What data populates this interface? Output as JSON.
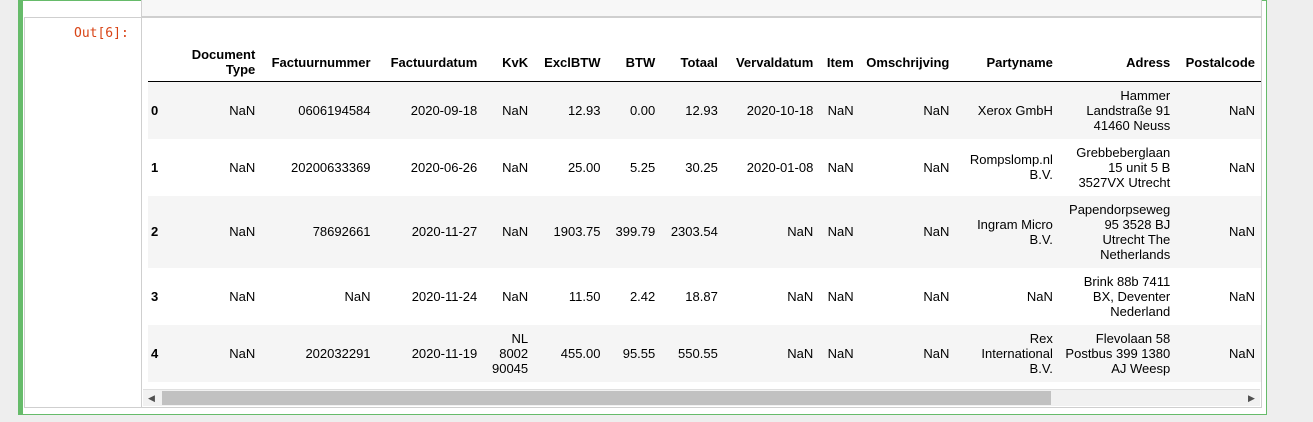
{
  "prompt": "Out[6]:",
  "columns": [
    "",
    "Document Type",
    "Factuurnummer",
    "Factuurdatum",
    "KvK",
    "ExclBTW",
    "BTW",
    "Totaal",
    "Vervaldatum",
    "Item",
    "Omschrijving",
    "Partyname",
    "Adress",
    "Postalcode"
  ],
  "rows": [
    [
      "0",
      "NaN",
      "0606194584",
      "2020-09-18",
      "NaN",
      "12.93",
      "0.00",
      "12.93",
      "2020-10-18",
      "NaN",
      "NaN",
      "Xerox GmbH",
      "Hammer Landstraße 91 41460 Neuss",
      "NaN"
    ],
    [
      "1",
      "NaN",
      "20200633369",
      "2020-06-26",
      "NaN",
      "25.00",
      "5.25",
      "30.25",
      "2020-01-08",
      "NaN",
      "NaN",
      "Rompslomp.nl B.V.",
      "Grebbeberglaan 15 unit 5 B 3527VX Utrecht",
      "NaN"
    ],
    [
      "2",
      "NaN",
      "78692661",
      "2020-11-27",
      "NaN",
      "1903.75",
      "399.79",
      "2303.54",
      "NaN",
      "NaN",
      "NaN",
      "Ingram Micro B.V.",
      "Papendorpseweg 95 3528 BJ Utrecht The Netherlands",
      "NaN"
    ],
    [
      "3",
      "NaN",
      "NaN",
      "2020-11-24",
      "NaN",
      "11.50",
      "2.42",
      "18.87",
      "NaN",
      "NaN",
      "NaN",
      "NaN",
      "Brink 88b 7411 BX, Deventer Nederland",
      "NaN"
    ],
    [
      "4",
      "NaN",
      "202032291",
      "2020-11-19",
      "NL 8002 90045",
      "455.00",
      "95.55",
      "550.55",
      "NaN",
      "NaN",
      "NaN",
      "Rex International B.V.",
      "Flevolaan 58 Postbus 399 1380 AJ Weesp",
      "NaN"
    ]
  ],
  "scrollbar": {
    "left_arrow": "◀",
    "right_arrow": "▶"
  }
}
